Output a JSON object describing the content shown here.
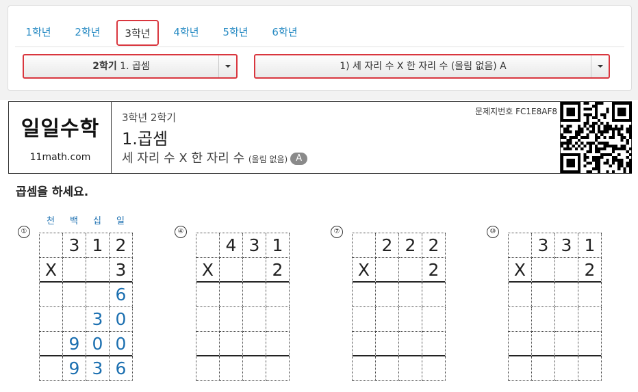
{
  "grade_tabs": [
    "1학년",
    "2학년",
    "3학년",
    "4학년",
    "5학년",
    "6학년"
  ],
  "active_tab": "3학년",
  "semester_select": {
    "semester": "2학기",
    "unit": "1. 곱셈"
  },
  "topic_select": {
    "value": "1) 세 자리 수 X 한 자리 수 (올림 없음) A"
  },
  "sheet": {
    "logo": "일일수학",
    "site": "11math.com",
    "grade_semester": "3학년 2학기",
    "chapter": "1.곱셈",
    "subtitle": "세 자리 수 X 한 자리 수",
    "subtitle_note": "(올림 없음)",
    "level": "A",
    "code_label": "문제지번호 FC1E8AF8",
    "instruction": "곱셈을 하세요."
  },
  "place_labels": [
    "천",
    "백",
    "십",
    "일"
  ],
  "problems": [
    {
      "number": "①",
      "rows": [
        [
          "",
          "3",
          "1",
          "2"
        ],
        [
          "X",
          "",
          "",
          "3"
        ],
        [
          "",
          "",
          "",
          "6"
        ],
        [
          "",
          "",
          "3",
          "0"
        ],
        [
          "",
          "9",
          "0",
          "0"
        ],
        [
          "",
          "9",
          "3",
          "6"
        ]
      ]
    },
    {
      "number": "④",
      "rows": [
        [
          "",
          "4",
          "3",
          "1"
        ],
        [
          "X",
          "",
          "",
          "2"
        ],
        [
          "",
          "",
          "",
          ""
        ],
        [
          "",
          "",
          "",
          ""
        ],
        [
          "",
          "",
          "",
          ""
        ],
        [
          "",
          "",
          "",
          ""
        ]
      ]
    },
    {
      "number": "⑦",
      "rows": [
        [
          "",
          "2",
          "2",
          "2"
        ],
        [
          "X",
          "",
          "",
          "2"
        ],
        [
          "",
          "",
          "",
          ""
        ],
        [
          "",
          "",
          "",
          ""
        ],
        [
          "",
          "",
          "",
          ""
        ],
        [
          "",
          "",
          "",
          ""
        ]
      ]
    },
    {
      "number": "⑩",
      "rows": [
        [
          "",
          "3",
          "3",
          "1"
        ],
        [
          "X",
          "",
          "",
          "2"
        ],
        [
          "",
          "",
          "",
          ""
        ],
        [
          "",
          "",
          "",
          ""
        ],
        [
          "",
          "",
          "",
          ""
        ],
        [
          "",
          "",
          "",
          ""
        ]
      ]
    }
  ],
  "colors": {
    "accent_red": "#d9363e",
    "tab_blue": "#2a8cc4",
    "answer_blue": "#1b6fb0"
  },
  "icons": {
    "dropdown": "chevron-down-icon",
    "qr": "qr-code-icon"
  }
}
